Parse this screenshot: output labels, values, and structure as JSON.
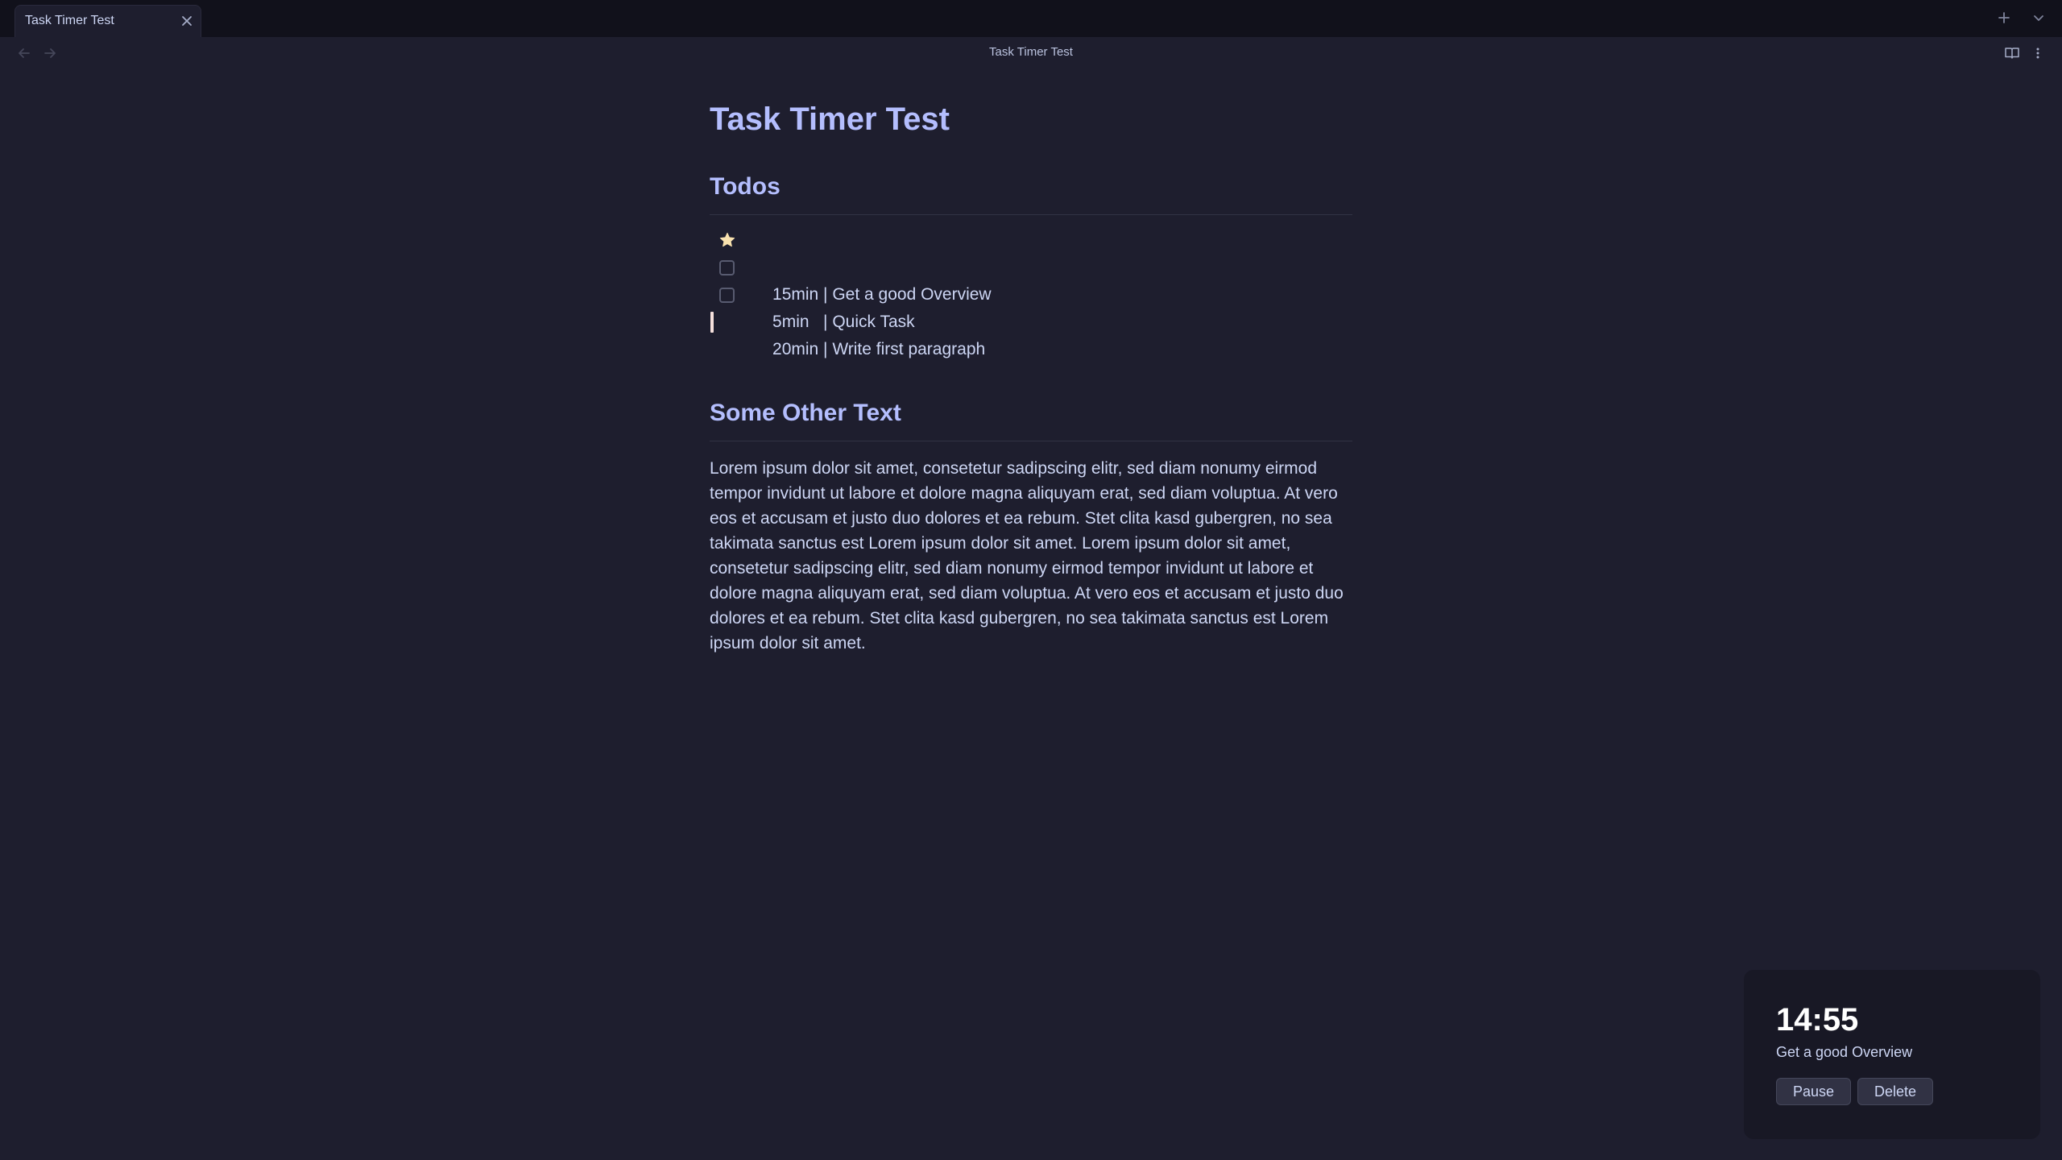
{
  "tab": {
    "title": "Task Timer Test"
  },
  "header": {
    "view_title": "Task Timer Test"
  },
  "document": {
    "title": "Task Timer Test",
    "section1": {
      "heading": "Todos",
      "todos": [
        {
          "text": "15min | Get a good Overview",
          "status": "starred"
        },
        {
          "text": "5min   | Quick Task",
          "status": "unchecked"
        },
        {
          "text": "20min | Write first paragraph",
          "status": "unchecked"
        }
      ]
    },
    "section2": {
      "heading": "Some Other Text",
      "paragraph": "Lorem ipsum dolor sit amet, consetetur sadipscing elitr, sed diam nonumy eirmod tempor invidunt ut labore et dolore magna aliquyam erat, sed diam voluptua. At vero eos et accusam et justo duo dolores et ea rebum. Stet clita kasd gubergren, no sea takimata sanctus est Lorem ipsum dolor sit amet. Lorem ipsum dolor sit amet, consetetur sadipscing elitr, sed diam nonumy eirmod tempor invidunt ut labore et dolore magna aliquyam erat, sed diam voluptua. At vero eos et accusam et justo duo dolores et ea rebum. Stet clita kasd gubergren, no sea takimata sanctus est Lorem ipsum dolor sit amet."
    }
  },
  "timer": {
    "time": "14:55",
    "task": "Get a good Overview",
    "pause_label": "Pause",
    "delete_label": "Delete"
  },
  "colors": {
    "background": "#1e1e2e",
    "tabbar": "#11111b",
    "heading": "#b4befe",
    "text": "#cdd6f4",
    "star": "#f9e2af",
    "caret": "#f5e0dc",
    "timer_bg": "#181825"
  },
  "icons": {
    "tab_close": "close-icon",
    "new_tab": "plus-icon",
    "tab_list": "chevron-down-icon",
    "back": "arrow-left-icon",
    "forward": "arrow-right-icon",
    "reading_view": "book-open-icon",
    "more_options": "more-vertical-icon",
    "starred_task": "star-icon"
  }
}
